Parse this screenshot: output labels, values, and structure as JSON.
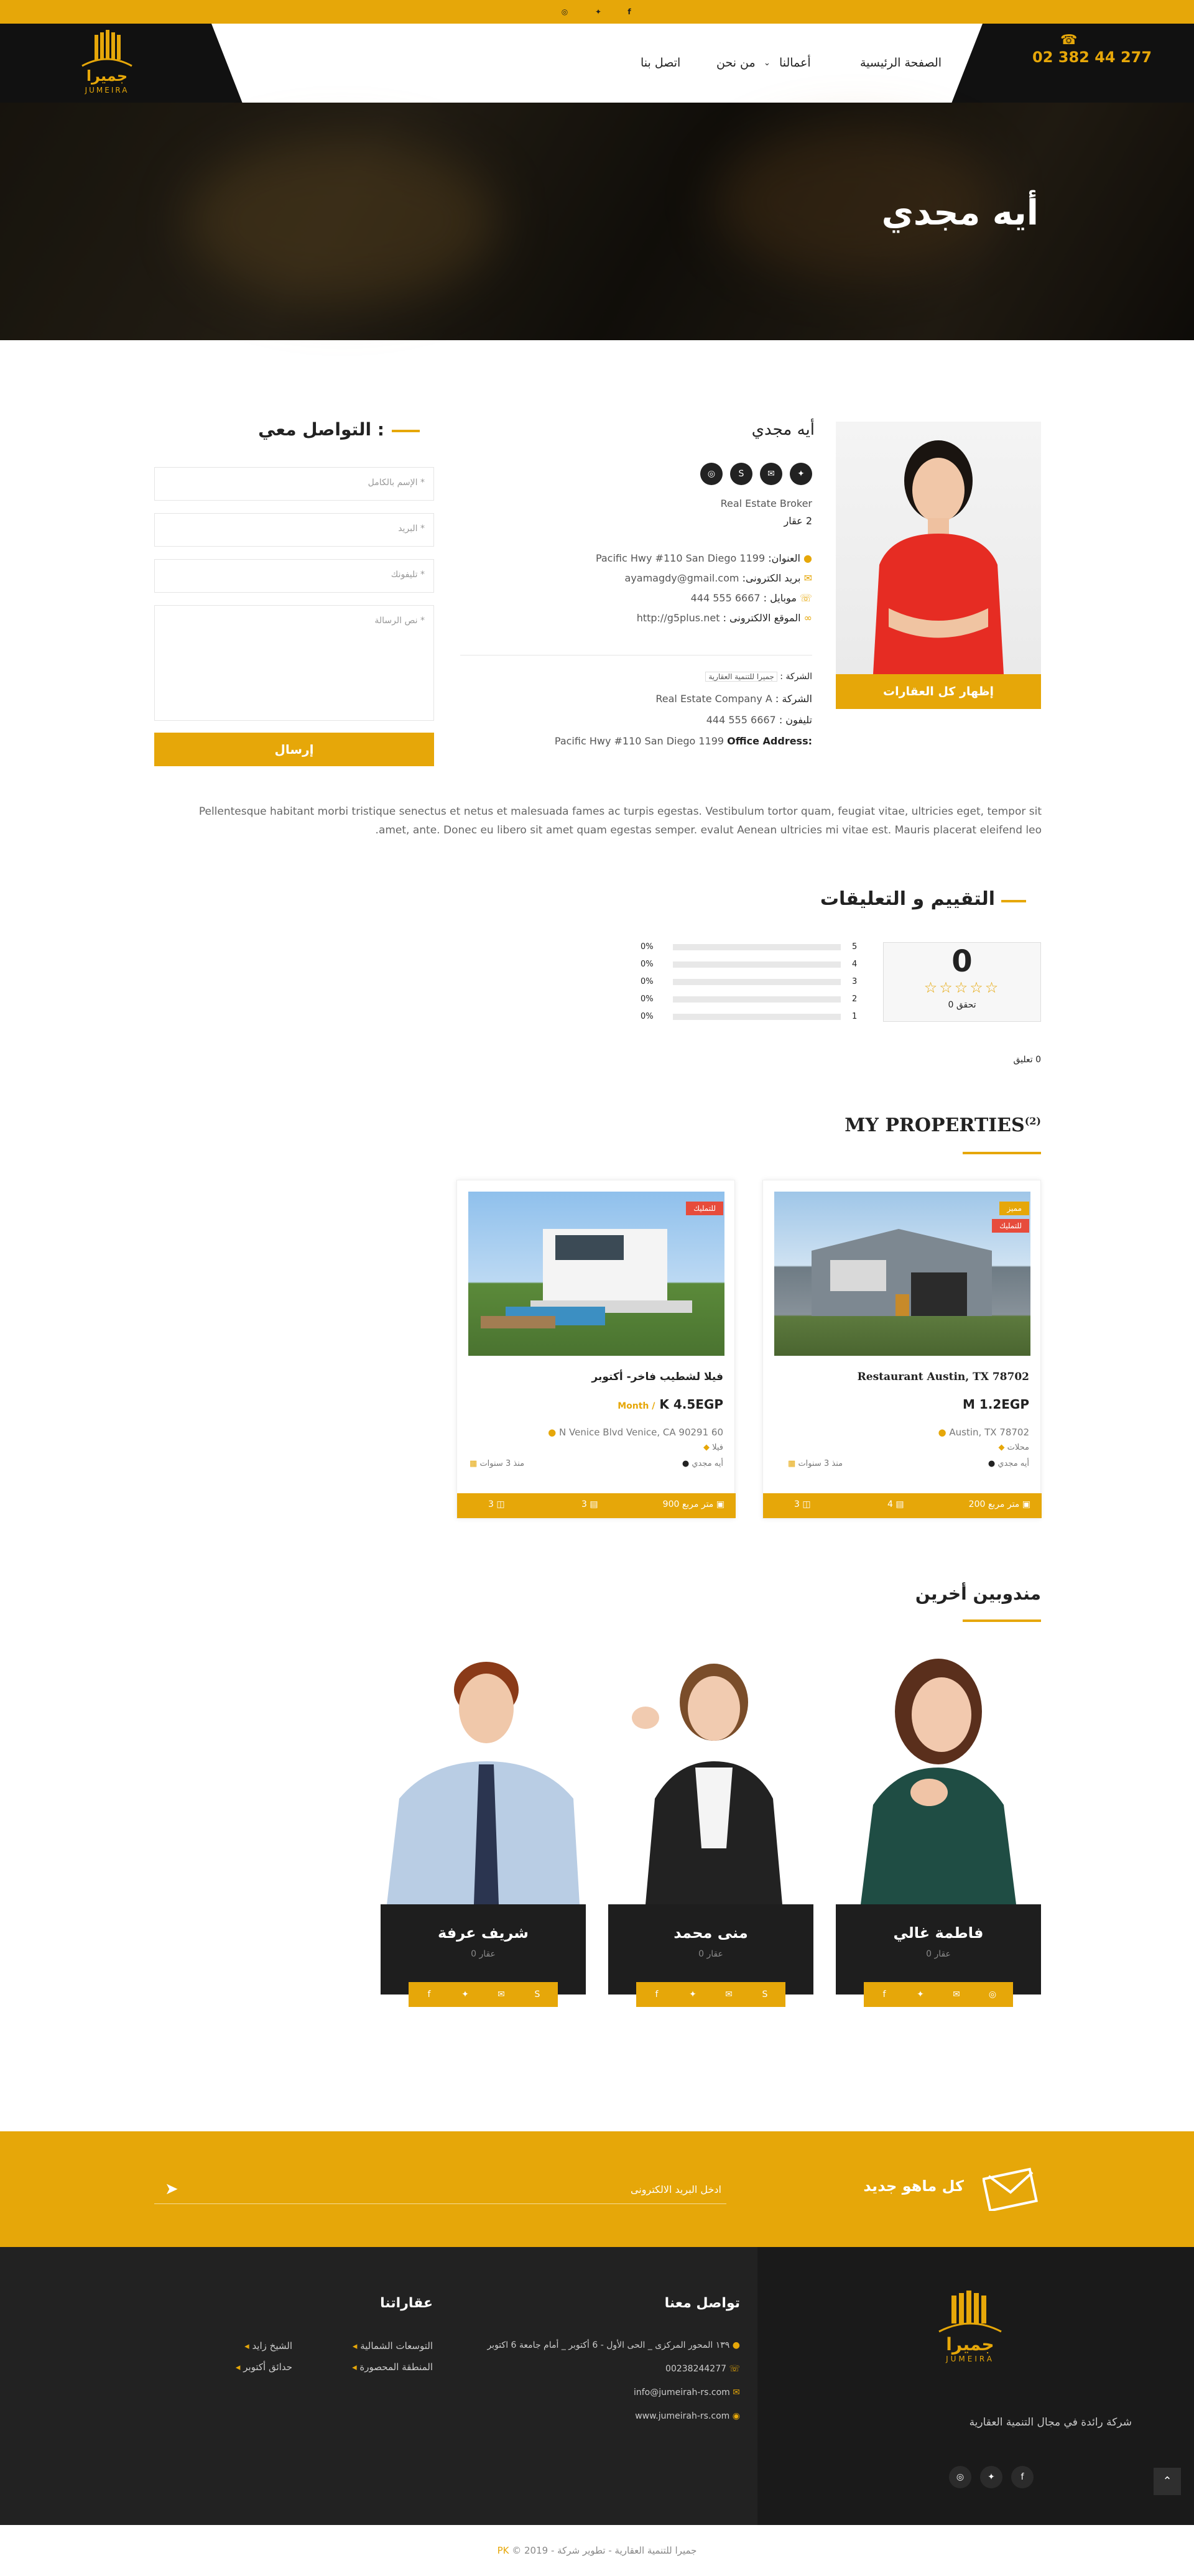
{
  "brand": {
    "logo_text_ar": "جميرا",
    "logo_text_en": "JUMEIRA",
    "accent": "#e6a709",
    "dark": "#222222"
  },
  "topbar": {
    "icons": [
      "instagram-icon",
      "twitter-icon",
      "facebook-icon"
    ]
  },
  "nav": {
    "phone": "02 382 44 277",
    "items": [
      "الصفحة الرئيسية",
      "أعمالنا",
      "من نحن",
      "اتصل بنا"
    ]
  },
  "hero": {
    "title": "أيه مجدي"
  },
  "agent": {
    "name": "أيه مجدي",
    "role": "Real Estate Broker",
    "count": "2 عقار",
    "show_all": "إظهار كل العقارات",
    "address_label": "العنوان:",
    "address": "Pacific Hwy #110 San Diego 1199",
    "email_label": "بريد الكترونى:",
    "email": "ayamagdy@gmail.com",
    "mobile_label": "موبايل :",
    "mobile": "6667 555 444",
    "website_label": "الموقع الالكترونى :",
    "website": "http://g5plus.net",
    "company_label": "الشركة :",
    "company_name_ar": "جميرا للتنمية العقارية",
    "company_label2": "الشركة :",
    "company": "Real Estate Company A",
    "phone_label": "تليفون :",
    "phone": "6667 555 444",
    "office_label": "Office Address:",
    "office": "Pacific Hwy #110 San Diego 1199",
    "bio": "Pellentesque habitant morbi tristique senectus et netus et malesuada fames ac turpis egestas. Vestibulum tortor quam, feugiat vitae, ultricies eget, tempor sit amet, ante. Donec eu libero sit amet quam egestas semper. evalut Aenean ultricies mi vitae est. Mauris placerat eleifend leo."
  },
  "contact": {
    "title": ": التواصل معي",
    "name_placeholder": "الإسم بالكامل *",
    "email_placeholder": "البريد *",
    "phone_placeholder": "تليفونك *",
    "message_placeholder": "نص الرسالة *",
    "send": "إرسال"
  },
  "reviews": {
    "title": "التقييم و التعليقات",
    "score": "0",
    "stars": 0,
    "votes": "0 تحقق",
    "rows": [
      {
        "n": "5",
        "pct": "0%"
      },
      {
        "n": "4",
        "pct": "0%"
      },
      {
        "n": "3",
        "pct": "0%"
      },
      {
        "n": "2",
        "pct": "0%"
      },
      {
        "n": "1",
        "pct": "0%"
      }
    ],
    "comments": "0 تعليق"
  },
  "properties": {
    "title": "MY PROPERTIES",
    "count": "(2)",
    "items": [
      {
        "tags": [
          "مميز",
          "للتمليك"
        ],
        "title": "Restaurant Austin, TX 78702",
        "price": "M 1.2EGP",
        "price_suffix": "",
        "location": "Austin, TX 78702",
        "type": "محلات",
        "agent": "أيه مجدي",
        "age": "منذ 3 سنوات",
        "area": "200 متر مربع",
        "beds": "4",
        "baths": "3"
      },
      {
        "tags": [
          "للتمليك"
        ],
        "title": "فيلا لشطيب فاخر- أكتوبر",
        "price": "K 4.5EGP",
        "price_suffix": "Month /",
        "location": "N Venice Blvd Venice, CA 90291 60",
        "type": "فيلا",
        "agent": "أيه مجدي",
        "age": "منذ 3 سنوات",
        "area": "900 متر مربع",
        "beds": "3",
        "baths": "3"
      }
    ]
  },
  "others": {
    "title": "مندوبين أخرين",
    "agents": [
      {
        "name": "فاطمة غالي",
        "count": "0 عقار"
      },
      {
        "name": "منى محمد",
        "count": "0 عقار"
      },
      {
        "name": "شريف عرفة",
        "count": "0 عقار"
      }
    ]
  },
  "newsletter": {
    "title": "كل ماهو جديد",
    "placeholder": "ادخل البريد الالكترونى"
  },
  "footer": {
    "tagline": "شركة رائدة في مجال التنمية العقارية",
    "contact_title": "تواصل معنا",
    "address": "١٣٩ المحور المركزى _ الحى الأول - 6 أكتوبر _ أمام جامعة 6 اكتوبر",
    "phone": "00238244277",
    "email": "info@jumeirah-rs.com",
    "web": "www.jumeirah-rs.com",
    "projects_title": "عقاراتنا",
    "projects": [
      "التوسعات الشمالية",
      "الشيخ زايد",
      "المنطقة المحصورة",
      "حدائق أكتوبر"
    ],
    "copyright": "© 2019 - جميرا للتنمية العقارية - تطوير شركة",
    "copyright_brand": "PK"
  }
}
